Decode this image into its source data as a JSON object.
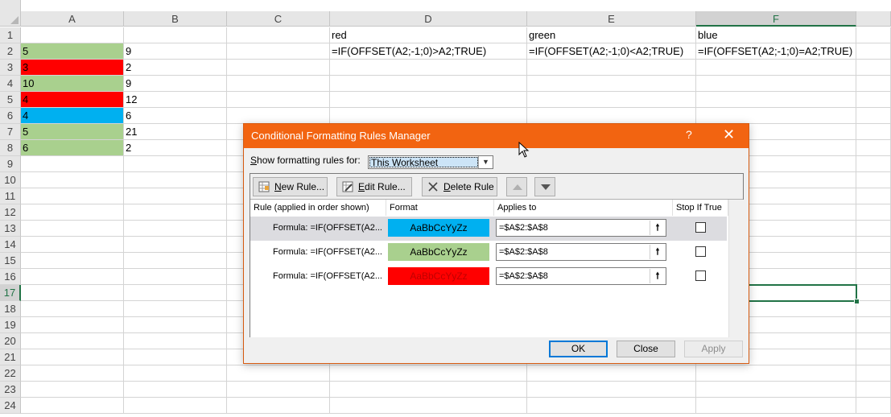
{
  "columns": [
    "A",
    "B",
    "C",
    "D",
    "E",
    "F"
  ],
  "selected_column": "F",
  "rows": [
    "1",
    "2",
    "3",
    "4",
    "5",
    "6",
    "7",
    "8",
    "9",
    "10",
    "11",
    "12",
    "13",
    "14",
    "15",
    "16",
    "17",
    "18",
    "19",
    "20",
    "21",
    "22",
    "23",
    "24"
  ],
  "selected_row": "17",
  "cells": {
    "D1": "red",
    "E1": "green",
    "F1": "blue",
    "D2": "=IF(OFFSET(A2;-1;0)>A2;TRUE)",
    "E2": "=IF(OFFSET(A2;-1;0)<A2;TRUE)",
    "F2": "=IF(OFFSET(A2;-1;0)=A2;TRUE)",
    "A2": "5",
    "B2": "9",
    "A3": "3",
    "B3": "2",
    "A4": "10",
    "B4": "9",
    "A5": "4",
    "B5": "12",
    "A6": "4",
    "B6": "6",
    "A7": "5",
    "B7": "21",
    "A8": "6",
    "B8": "2"
  },
  "cell_fills": {
    "A2": "#a9d08e",
    "A3": "#ff0000",
    "A4": "#a9d08e",
    "A5": "#ff0000",
    "A6": "#00b0f0",
    "A7": "#a9d08e",
    "A8": "#a9d08e"
  },
  "dialog": {
    "title": "Conditional Formatting Rules Manager",
    "help": "?",
    "close": "✕",
    "show_rules_label_hotkey": "S",
    "show_rules_label_rest": "how formatting rules for:",
    "scope_value": "This Worksheet",
    "toolbar": {
      "new_rule_hotkey": "N",
      "new_rule_rest": "ew Rule...",
      "edit_rule_hotkey": "E",
      "edit_rule_rest": "dit Rule...",
      "delete_rule_hotkey": "D",
      "delete_rule_rest": "elete Rule"
    },
    "headers": {
      "rule": "Rule (applied in order shown)",
      "format": "Format",
      "applies_to": "Applies to",
      "stop_if_true": "Stop If True"
    },
    "rules": [
      {
        "label": "Formula: =IF(OFFSET(A2...",
        "format_text": "AaBbCcYyZz",
        "format_fill": "#00b0f0",
        "format_color": "#000000",
        "applies_to": "=$A$2:$A$8",
        "stop": false,
        "selected": true
      },
      {
        "label": "Formula: =IF(OFFSET(A2...",
        "format_text": "AaBbCcYyZz",
        "format_fill": "#a9d08e",
        "format_color": "#000000",
        "applies_to": "=$A$2:$A$8",
        "stop": false,
        "selected": false
      },
      {
        "label": "Formula: =IF(OFFSET(A2...",
        "format_text": "AaBbCcYyZz",
        "format_fill": "#ff0000",
        "format_color": "#c00000",
        "applies_to": "=$A$2:$A$8",
        "stop": false,
        "selected": false
      }
    ],
    "ref_button_glyph": "🠕",
    "buttons": {
      "ok": "OK",
      "close": "Close",
      "apply": "Apply"
    }
  },
  "colors": {
    "title_bar": "#f26411",
    "accent": "#217346"
  }
}
